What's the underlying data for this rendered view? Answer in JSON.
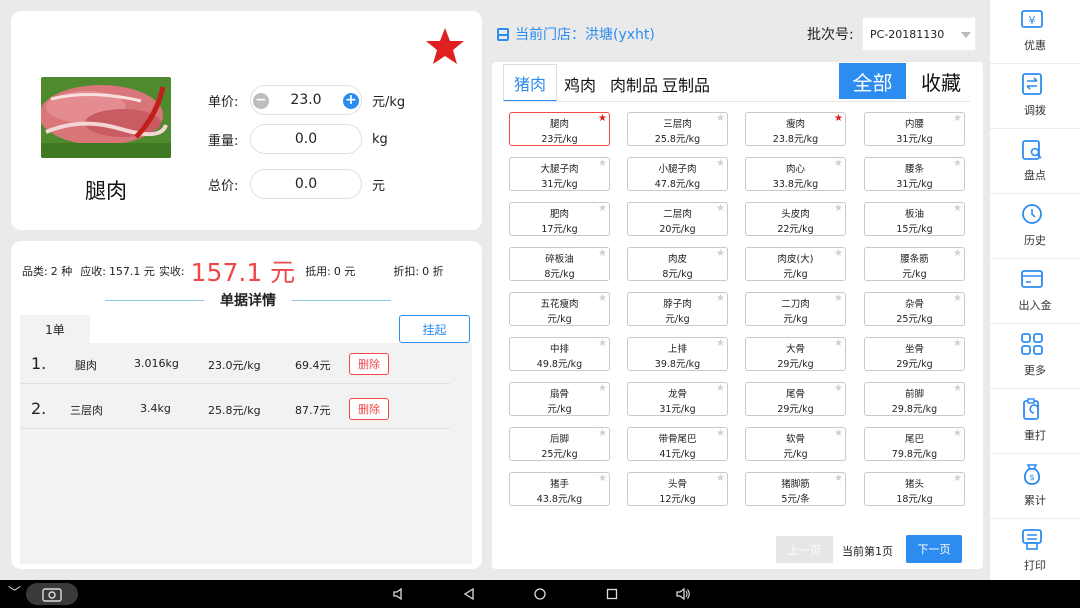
{
  "product": {
    "name": "腿肉",
    "unit_price_label": "单价:",
    "unit_price": "23.0",
    "unit_price_unit": "元/kg",
    "weight_label": "重量:",
    "weight": "0.0",
    "weight_unit": "kg",
    "total_label": "总价:",
    "total": "0.0",
    "total_unit": "元"
  },
  "summary": {
    "kinds_label": "品类:",
    "kinds": "2 种",
    "receivable_label": "应收:",
    "receivable": "157.1 元",
    "received_label": "实收:",
    "received": "157.1 元",
    "offset_label": "抵用:",
    "offset": "0 元",
    "discount_label": "折扣:",
    "discount": "0 折"
  },
  "order": {
    "detail_title": "单据详情",
    "tab": "1单",
    "hang_label": "挂起",
    "delete_label": "删除",
    "rows": [
      {
        "idx": "1.",
        "name": "腿肉",
        "weight": "3.016kg",
        "price": "23.0元/kg",
        "amount": "69.4元"
      },
      {
        "idx": "2.",
        "name": "三层肉",
        "weight": "3.4kg",
        "price": "25.8元/kg",
        "amount": "87.7元"
      }
    ]
  },
  "header": {
    "store": "当前门店：洪塘(yxht)",
    "batch_label": "批次号:",
    "batch_value": "PC-20181130"
  },
  "categories": {
    "tabs": [
      "猪肉",
      "鸡肉",
      "肉制品",
      "豆制品"
    ],
    "all_label": "全部",
    "fav_label": "收藏"
  },
  "items": [
    {
      "name": "腿肉",
      "price": "23元/kg",
      "fav": true,
      "selected": true
    },
    {
      "name": "三层肉",
      "price": "25.8元/kg",
      "fav": false
    },
    {
      "name": "瘦肉",
      "price": "23.8元/kg",
      "fav": true
    },
    {
      "name": "内腰",
      "price": "31元/kg",
      "fav": false
    },
    {
      "name": "大腿子肉",
      "price": "31元/kg",
      "fav": false
    },
    {
      "name": "小腿子肉",
      "price": "47.8元/kg",
      "fav": false
    },
    {
      "name": "肉心",
      "price": "33.8元/kg",
      "fav": false
    },
    {
      "name": "腰条",
      "price": "31元/kg",
      "fav": false
    },
    {
      "name": "肥肉",
      "price": "17元/kg",
      "fav": false
    },
    {
      "name": "二层肉",
      "price": "20元/kg",
      "fav": false
    },
    {
      "name": "头皮肉",
      "price": "22元/kg",
      "fav": false
    },
    {
      "name": "板油",
      "price": "15元/kg",
      "fav": false
    },
    {
      "name": "碎板油",
      "price": "8元/kg",
      "fav": false
    },
    {
      "name": "肉皮",
      "price": "8元/kg",
      "fav": false
    },
    {
      "name": "肉皮(大)",
      "price": "元/kg",
      "fav": false
    },
    {
      "name": "腰条筋",
      "price": "元/kg",
      "fav": false
    },
    {
      "name": "五花瘦肉",
      "price": "元/kg",
      "fav": false
    },
    {
      "name": "脖子肉",
      "price": "元/kg",
      "fav": false
    },
    {
      "name": "二刀肉",
      "price": "元/kg",
      "fav": false
    },
    {
      "name": "杂骨",
      "price": "25元/kg",
      "fav": false
    },
    {
      "name": "中排",
      "price": "49.8元/kg",
      "fav": false
    },
    {
      "name": "上排",
      "price": "39.8元/kg",
      "fav": false
    },
    {
      "name": "大骨",
      "price": "29元/kg",
      "fav": false
    },
    {
      "name": "坐骨",
      "price": "29元/kg",
      "fav": false
    },
    {
      "name": "扇骨",
      "price": "元/kg",
      "fav": false
    },
    {
      "name": "龙骨",
      "price": "31元/kg",
      "fav": false
    },
    {
      "name": "尾骨",
      "price": "29元/kg",
      "fav": false
    },
    {
      "name": "前脚",
      "price": "29.8元/kg",
      "fav": false
    },
    {
      "name": "后脚",
      "price": "25元/kg",
      "fav": false
    },
    {
      "name": "带骨尾巴",
      "price": "41元/kg",
      "fav": false
    },
    {
      "name": "软骨",
      "price": "元/kg",
      "fav": false
    },
    {
      "name": "尾巴",
      "price": "79.8元/kg",
      "fav": false
    },
    {
      "name": "猪手",
      "price": "43.8元/kg",
      "fav": false
    },
    {
      "name": "头骨",
      "price": "12元/kg",
      "fav": false
    },
    {
      "name": "猪脚筋",
      "price": "5元/条",
      "fav": false
    },
    {
      "name": "猪头",
      "price": "18元/kg",
      "fav": false
    }
  ],
  "pagination": {
    "prev": "上一页",
    "current": "当前第1页",
    "next": "下一页"
  },
  "sidebar": [
    {
      "label": "优惠",
      "icon": "coupon-icon"
    },
    {
      "label": "调拨",
      "icon": "transfer-icon"
    },
    {
      "label": "盘点",
      "icon": "inventory-icon"
    },
    {
      "label": "历史",
      "icon": "history-icon"
    },
    {
      "label": "出入金",
      "icon": "cash-icon"
    },
    {
      "label": "更多",
      "icon": "more-icon"
    },
    {
      "label": "重打",
      "icon": "reprint-icon"
    },
    {
      "label": "累计",
      "icon": "money-bag-icon"
    },
    {
      "label": "打印",
      "icon": "print-icon"
    }
  ],
  "colors": {
    "accent": "#2d8cf0",
    "danger": "#f04848",
    "star": "#e02020"
  }
}
